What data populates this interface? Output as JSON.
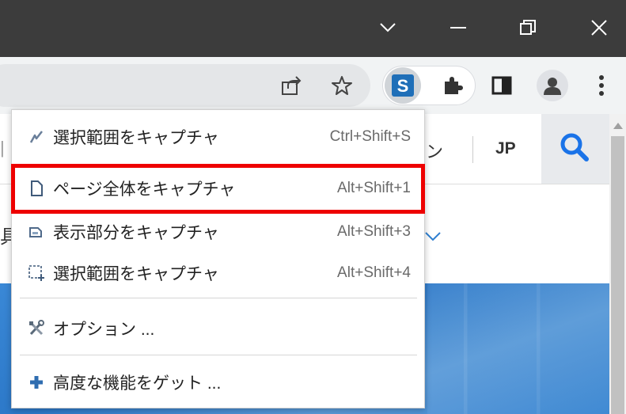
{
  "window_controls": {
    "dropdown": "chevron-down-icon",
    "minimize": "minimize-icon",
    "restore": "restore-icon",
    "close": "close-icon"
  },
  "toolbar": {
    "icons": [
      "share-icon",
      "star-icon",
      "screenshot-extension-icon",
      "puzzle-icon",
      "side-panel-icon",
      "profile-icon",
      "kebab-menu-icon"
    ],
    "extension_letter": "S"
  },
  "page": {
    "nav_partial": "ン",
    "language": "JP",
    "left_partial_1": "|",
    "left_partial_2": "具",
    "chevron": "chevron-down-icon"
  },
  "menu": {
    "groups": [
      [
        {
          "label": "選択範囲をキャプチャ",
          "shortcut": "Ctrl+Shift+S",
          "icon": "pen-icon"
        },
        {
          "label": "ページ全体をキャプチャ",
          "shortcut": "Alt+Shift+1",
          "icon": "page-icon"
        },
        {
          "label": "表示部分をキャプチャ",
          "shortcut": "Alt+Shift+3",
          "icon": "visible-area-icon"
        },
        {
          "label": "選択範囲をキャプチャ",
          "shortcut": "Alt+Shift+4",
          "icon": "selection-icon"
        }
      ],
      [
        {
          "label": "オプション ...",
          "shortcut": "",
          "icon": "tools-icon"
        }
      ],
      [
        {
          "label": "高度な機能をゲット ...",
          "shortcut": "",
          "icon": "plus-icon"
        }
      ]
    ]
  },
  "colors": {
    "highlight": "#ee0000",
    "title_bar": "#3c3c3c",
    "toolbar": "#f1f3f4",
    "page_accent": "#2f7fd0",
    "search_icon": "#1a73e8"
  }
}
